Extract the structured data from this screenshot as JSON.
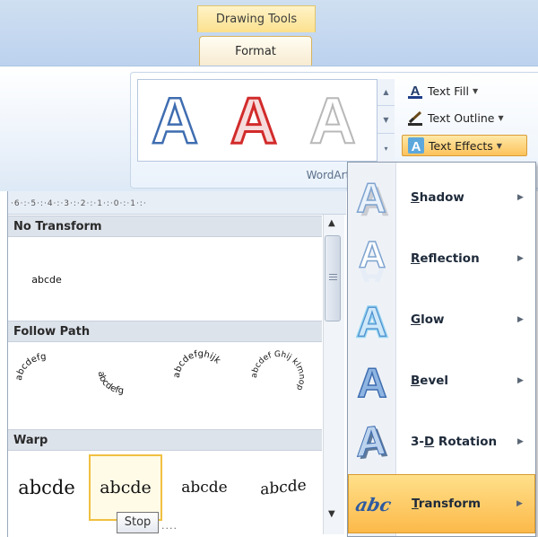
{
  "contextual_tab": "Drawing Tools",
  "active_tab": "Format",
  "group_label": "WordArt St",
  "buttons": {
    "text_fill": "Text Fill",
    "text_outline": "Text Outline",
    "text_effects": "Text Effects"
  },
  "ruler_text": "·6·:·5·:·4·:·3·:·2·:·1·:·0·:·1·:·",
  "panel": {
    "sections": [
      "No Transform",
      "Follow Path",
      "Warp"
    ],
    "no_transform_sample": "abcde",
    "follow_path_samples": [
      "abcdefg",
      "abcdefg",
      "abcdefghijk",
      "abcdef Ghij klmnop"
    ],
    "warp_samples": [
      "abcde",
      "abcde",
      "abcde",
      "abcde"
    ],
    "tooltip": "Stop"
  },
  "menu": {
    "items": [
      {
        "pre": "",
        "key": "S",
        "post": "hadow"
      },
      {
        "pre": "",
        "key": "R",
        "post": "eflection"
      },
      {
        "pre": "",
        "key": "G",
        "post": "low"
      },
      {
        "pre": "",
        "key": "B",
        "post": "evel"
      },
      {
        "pre": "3-",
        "key": "D",
        "post": " Rotation"
      },
      {
        "pre": "",
        "key": "T",
        "post": "ransform"
      }
    ]
  },
  "colors": {
    "accent_gold": "#fcc25b",
    "ribbon_blue": "#bcd2ee",
    "wordart_blue": "#3f6db0",
    "wordart_red": "#d22b2b"
  }
}
